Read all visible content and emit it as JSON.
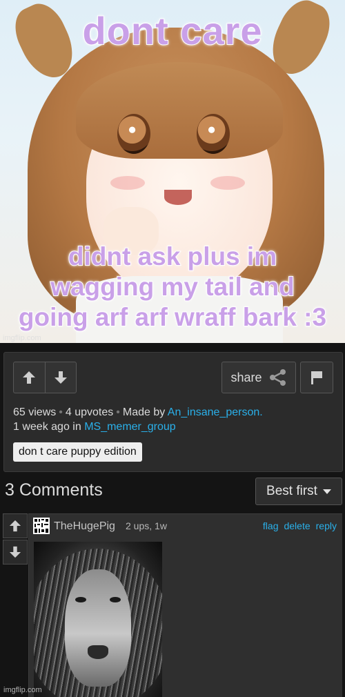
{
  "meme": {
    "caption_top": "dont care",
    "caption_bottom_line1": "didnt ask plus im",
    "caption_bottom_line2": "wagging my tail and",
    "caption_bottom_line3": "going arf arf wraff bark :3",
    "watermark": "imgflip.com"
  },
  "post": {
    "upvote_icon": "arrow-up-icon",
    "downvote_icon": "arrow-down-icon",
    "share_label": "share",
    "share_icon": "share-icon",
    "flag_icon": "flag-icon",
    "views": "65 views",
    "upvotes": "4 upvotes",
    "made_by_prefix": "Made by",
    "author": "An_insane_person.",
    "time_prefix": "1 week ago in",
    "stream": "MS_memer_group",
    "tag": "don t care puppy edition",
    "link_color": "#2ab0ea"
  },
  "comments": {
    "title": "3 Comments",
    "sort_label": "Best first",
    "items": [
      {
        "username": "TheHugePig",
        "meta": "2 ups, 1w",
        "actions": [
          "flag",
          "delete",
          "reply"
        ],
        "image_watermark": "imgflip.com"
      }
    ]
  }
}
